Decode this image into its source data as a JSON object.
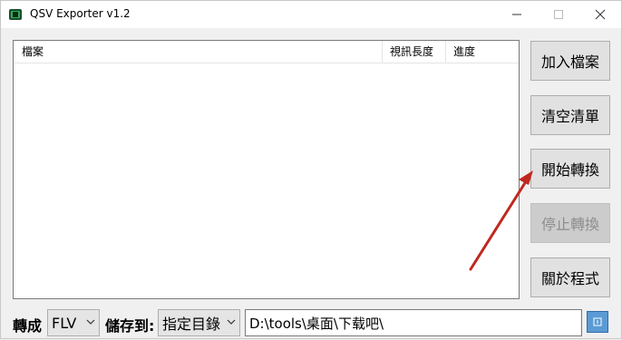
{
  "window": {
    "title": "QSV Exporter v1.2",
    "controls": {
      "minimize": "—",
      "maximize": "☐",
      "close": "✕"
    }
  },
  "file_list": {
    "columns": [
      "檔案",
      "視訊長度",
      "進度"
    ],
    "rows": []
  },
  "buttons": {
    "add_file": "加入檔案",
    "clear_list": "清空清單",
    "start_convert": "開始轉換",
    "stop_convert": "停止轉換",
    "about": "關於程式"
  },
  "bottom": {
    "convert_label": "轉成",
    "format_selected": "FLV",
    "save_label": "儲存到:",
    "target_selected": "指定目錄",
    "path": "D:\\tools\\桌面\\下载吧\\"
  },
  "colors": {
    "annotation_arrow": "#c0281f",
    "browse_button": "#5b9bd5"
  }
}
